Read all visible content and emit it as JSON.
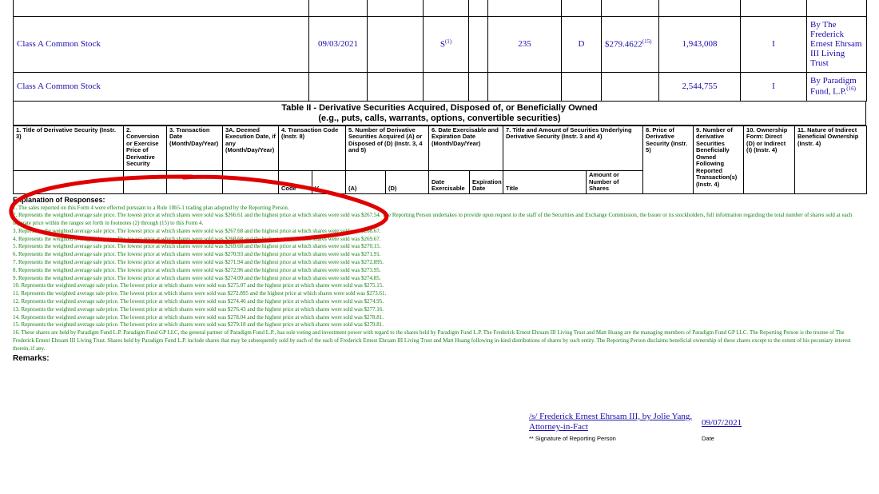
{
  "table1": {
    "rows": [
      {
        "title": "Class A Common Stock",
        "date": "09/03/2021",
        "code": "S",
        "code_note": "(1)",
        "amount": "235",
        "ad": "D",
        "price": "$279.4622",
        "price_note": "(15)",
        "owned": "1,943,008",
        "form": "I",
        "nature": "By The Frederick Ernest Ehrsam III Living Trust",
        "nature_note": ""
      },
      {
        "title": "Class A Common Stock",
        "date": "",
        "code": "",
        "code_note": "",
        "amount": "",
        "ad": "",
        "price": "",
        "price_note": "",
        "owned": "2,544,755",
        "form": "I",
        "nature": "By Paradigm Fund, L.P.",
        "nature_note": "(16)"
      }
    ]
  },
  "table2": {
    "title_line1": "Table II - Derivative Securities Acquired, Disposed of, or Beneficially Owned",
    "title_line2": "(e.g., puts, calls, warrants, options, convertible securities)",
    "headers": [
      "1. Title of Derivative Security (Instr. 3)",
      "2. Conversion or Exercise Price of Derivative Security",
      "3. Transaction Date (Month/Day/Year)",
      "3A. Deemed Execution Date, if any (Month/Day/Year)",
      "4. Transaction Code (Instr. 8)",
      "5. Number of Derivative Securities Acquired (A) or Disposed of (D) (Instr. 3, 4 and 5)",
      "6. Date Exercisable and Expiration Date (Month/Day/Year)",
      "7. Title and Amount of Securities Underlying Derivative Security (Instr. 3 and 4)",
      "8. Price of Derivative Security (Instr. 5)",
      "9. Number of derivative Securities Beneficially Owned Following Reported Transaction(s) (Instr. 4)",
      "10. Ownership Form: Direct (D) or Indirect (I) (Instr. 4)",
      "11. Nature of Indirect Beneficial Ownership (Instr. 4)"
    ],
    "sub": {
      "code": "Code",
      "v": "V",
      "a": "(A)",
      "d": "(D)",
      "date_ex": "Date Exercisable",
      "exp": "Expiration Date",
      "title": "Title",
      "amount": "Amount or Number of Shares"
    }
  },
  "explanation": {
    "heading": "Explanation of Responses:",
    "footnotes": [
      "1. The sales reported on this Form 4 were effected pursuant to a Rule 10b5-1 trading plan adopted by the Reporting Person.",
      "2. Represents the weighted average sale price. The lowest price at which shares were sold was $266.61 and the highest price at which shares were sold was $267.54. The Reporting Person undertakes to provide upon request to the staff of the Securities and Exchange Commission, the Issuer or its stockholders, full information regarding the total number of shares sold at each separate price within the ranges set forth in footnotes (2) through (15) to this Form 4.",
      "3. Represents the weighted average sale price. The lowest price at which shares were sold was $267.68 and the highest price at which shares were sold was $268.67.",
      "4. Represents the weighted average sale price. The lowest price at which shares were sold was $268.68 and the highest price at which shares were sold was $269.67.",
      "5. Represents the weighted average sale price. The lowest price at which shares were sold was $269.68 and the highest price at which shares were sold was $270.15.",
      "6. Represents the weighted average sale price. The lowest price at which shares were sold was $270.93 and the highest price at which shares were sold was $271.91.",
      "7. Represents the weighted average sale price. The lowest price at which shares were sold was $271.94 and the highest price at which shares were sold was $272.895.",
      "8. Represents the weighted average sale price. The lowest price at which shares were sold was $272.96 and the highest price at which shares were sold was $273.95.",
      "9. Represents the weighted average sale price. The lowest price at which shares were sold was $274.00 and the highest price at which shares were sold was $274.85.",
      "10. Represents the weighted average sale price. The lowest price at which shares were sold was $275.07 and the highest price at which shares were sold was $275.15.",
      "11. Represents the weighted average sale price. The lowest price at which shares were sold was $272.895 and the highest price at which shares were sold was $273.61.",
      "12. Represents the weighted average sale price. The lowest price at which shares were sold was $274.46 and the highest price at which shares were sold was $274.95.",
      "13. Represents the weighted average sale price. The lowest price at which shares were sold was $276.43 and the highest price at which shares were sold was $277.16.",
      "14. Represents the weighted average sale price. The lowest price at which shares were sold was $278.04 and the highest price at which shares were sold was $278.81.",
      "15. Represents the weighted average sale price. The lowest price at which shares were sold was $279.18 and the highest price at which shares were sold was $279.81.",
      "16. These shares are held by Paradigm Fund L.P. Paradigm Fund GP LLC, the general partner of Paradigm Fund L.P., has sole voting and investment power with regard to the shares held by Paradigm Fund L.P. The Frederick Ernest Ehrsam III Living Trust and Matt Huang are the managing members of Paradigm Fund GP LLC. The Reporting Person is the trustee of The Frederick Ernest Ehrsam III Living Trust. Shares held by Paradigm Fund L.P. include shares that may be subsequently sold by each of the each of Frederick Ernest Ehrsam III Living Trust and Matt Huang following in-kind distributions of shares by such entity. The Reporting Person disclaims beneficial ownership of these shares except to the extent of his pecuniary interest therein, if any."
    ]
  },
  "remarks": {
    "heading": "Remarks:"
  },
  "signature": {
    "name": "/s/ Frederick Ernest Ehrsam III, by Jolie Yang, Attorney-in-Fact",
    "date": "09/07/2021",
    "name_label": "** Signature of Reporting Person",
    "date_label": "Date"
  },
  "colors": {
    "link": "#1a0dab",
    "footnote": "#108010",
    "annotation": "#e00000"
  }
}
